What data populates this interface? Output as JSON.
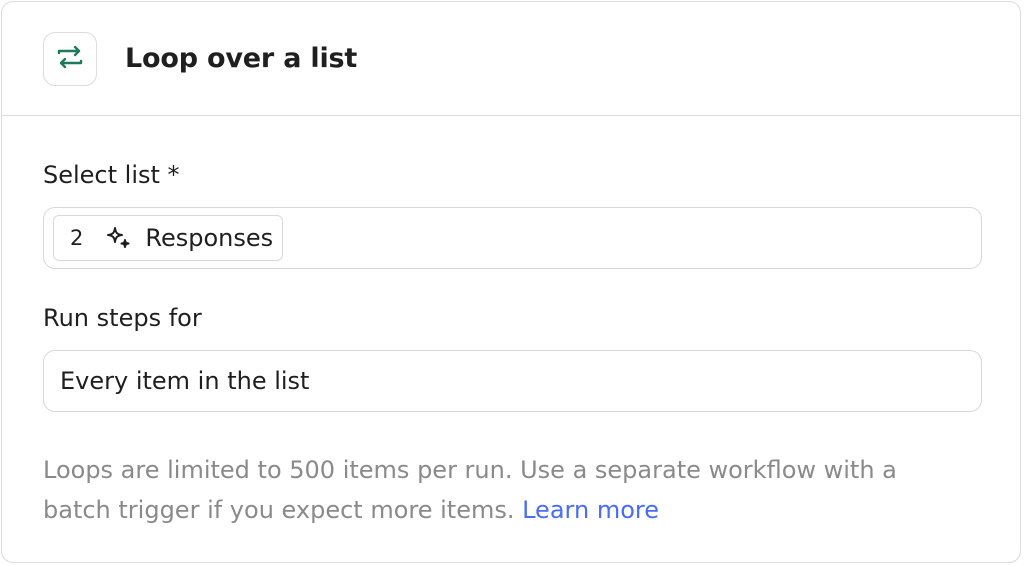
{
  "header": {
    "title": "Loop over a list",
    "icon": "loop-icon",
    "icon_color": "#1f7a5a"
  },
  "select_list": {
    "label": "Select list *",
    "chip": {
      "step_number": "2",
      "icon": "sparkle-icon",
      "text": "Responses"
    }
  },
  "run_steps": {
    "label": "Run steps for",
    "value": "Every item in the list"
  },
  "hint": {
    "text": "Loops are limited to 500 items per run. Use a separate workflow with a batch trigger if you expect more items. ",
    "link_text": "Learn more",
    "link_color": "#4a6cf7"
  }
}
